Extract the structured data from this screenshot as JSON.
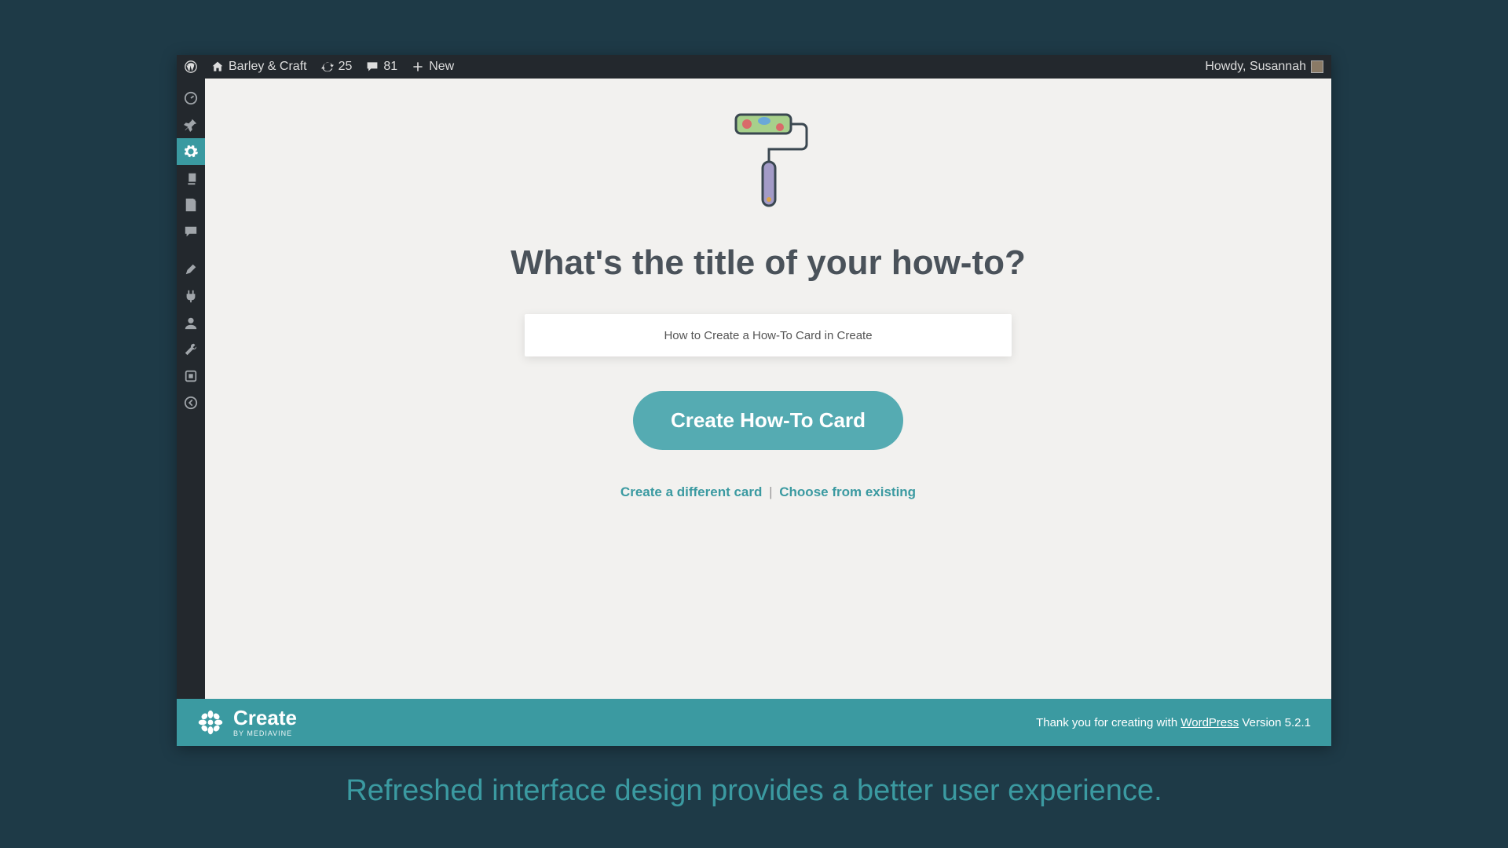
{
  "adminbar": {
    "site_name": "Barley & Craft",
    "updates_count": "25",
    "comments_count": "81",
    "new_label": "New",
    "howdy_prefix": "Howdy, ",
    "user_name": "Susannah"
  },
  "sidemenu": {
    "items": [
      {
        "name": "dashboard-icon"
      },
      {
        "name": "pin-icon"
      },
      {
        "name": "gear-icon",
        "active": true
      },
      {
        "name": "media-icon"
      },
      {
        "name": "pages-icon"
      },
      {
        "name": "comments-icon"
      }
    ],
    "group2": [
      {
        "name": "appearance-icon"
      },
      {
        "name": "plugins-icon"
      },
      {
        "name": "users-icon"
      },
      {
        "name": "tools-icon"
      },
      {
        "name": "settings-icon"
      },
      {
        "name": "collapse-icon"
      }
    ]
  },
  "main": {
    "heading": "What's the title of your how-to?",
    "title_input_value": "How to Create a How-To Card in Create",
    "create_button_label": "Create How-To Card",
    "alt_link_1": "Create a different card",
    "alt_link_2": "Choose from existing"
  },
  "footer": {
    "brand_name": "Create",
    "brand_sub": "BY MEDIAVINE",
    "thanks_prefix": "Thank you for creating with ",
    "thanks_link": "WordPress",
    "version_text": " Version 5.2.1"
  },
  "caption": "Refreshed interface design provides a better user experience."
}
